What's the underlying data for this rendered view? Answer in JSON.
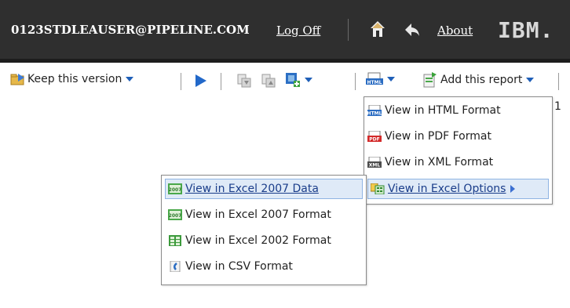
{
  "header": {
    "user_email": "0123STDLEAUSER@PIPELINE.COM",
    "logoff_label": "Log Off",
    "about_label": "About",
    "brand": "IBM."
  },
  "toolbar": {
    "keep_version_label": "Keep this version",
    "add_report_label": "Add this report"
  },
  "format_menu": {
    "items": [
      {
        "label": "View in HTML Format",
        "icon": "html-icon"
      },
      {
        "label": "View in PDF Format",
        "icon": "pdf-icon"
      },
      {
        "label": "View in XML Format",
        "icon": "xml-icon"
      },
      {
        "label": "View in Excel Options",
        "icon": "excel-options-icon"
      }
    ]
  },
  "excel_menu": {
    "items": [
      {
        "label": "View in Excel 2007 Data",
        "icon": "excel-2007-icon"
      },
      {
        "label": "View in Excel 2007 Format",
        "icon": "excel-2007-icon"
      },
      {
        "label": "View in Excel 2002 Format",
        "icon": "excel-2002-icon"
      },
      {
        "label": "View in CSV Format",
        "icon": "csv-icon"
      }
    ]
  },
  "stray_text": "1",
  "colors": {
    "header_bg": "#2f2f2f",
    "accent": "#1f5fb8",
    "highlight": "#dfeaf7"
  }
}
